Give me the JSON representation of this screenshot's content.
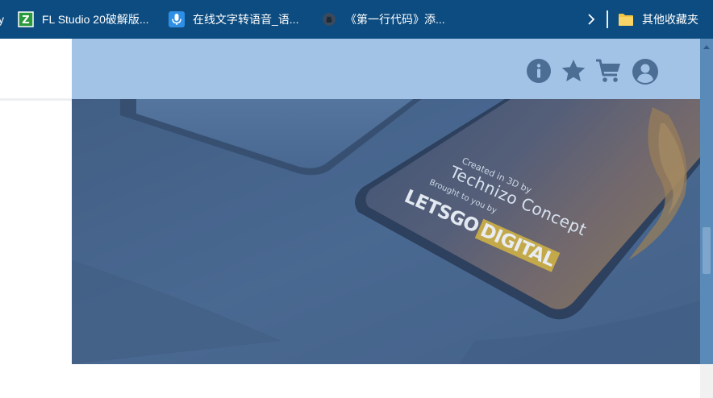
{
  "bookmarks": {
    "cut_item_label": "y",
    "items": [
      {
        "label": "FL Studio 20破解版...",
        "icon": "fl-studio-icon"
      },
      {
        "label": "在线文字转语音_语...",
        "icon": "microphone-icon"
      },
      {
        "label": "《第一行代码》添...",
        "icon": "github-icon"
      }
    ],
    "other_label": "其他收藏夹",
    "other_icon": "folder-icon"
  },
  "header": {
    "icons": [
      "info-icon",
      "star-icon",
      "cart-icon",
      "user-icon"
    ]
  },
  "hero": {
    "line1": "Created in 3D by",
    "line2": "Technizo Concept",
    "line3": "Brought to you by",
    "brand_main": "LETSGO",
    "brand_tag": "DIGITAL"
  },
  "colors": {
    "bookmarks_bar": "#0d4c80",
    "header_overlay": "#a2c3e6",
    "hero_overlay": "#4c6a90",
    "icon_color": "#4d6e94",
    "scrollbar": "#5a8ab8"
  }
}
